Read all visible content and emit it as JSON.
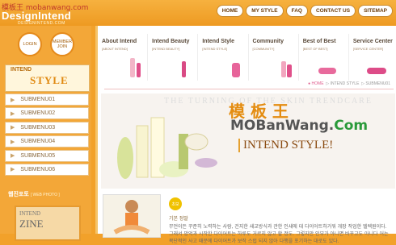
{
  "header": {
    "watermark": "模板王 mobanwang.com",
    "brand": "DesignIntend",
    "brand_sub": "DESIGNINTEND.COM",
    "nav": [
      "HOME",
      "MY STYLE",
      "FAQ",
      "CONTACT US",
      "SITEMAP"
    ]
  },
  "left": {
    "circles": [
      "LOGIN",
      "MEMBER JOIN"
    ],
    "style_label1": "INTEND",
    "style_label2": "STYLE",
    "menu": [
      "SUBMENU01",
      "SUBMENU02",
      "SUBMENU03",
      "SUBMENU04",
      "SUBMENU05",
      "SUBMENU06"
    ],
    "photo_title": "웹진포토",
    "photo_title_sub": "[ WEB PHOTO ]",
    "photo_t1": "INTEND",
    "photo_t2": "ZINE"
  },
  "categories": [
    {
      "title": "About Intend",
      "sub": "[ABOUT INTEND]"
    },
    {
      "title": "Intend Beauty",
      "sub": "[INTEND BEAUTY]"
    },
    {
      "title": "Intend Style",
      "sub": "[INTEND STYLE]"
    },
    {
      "title": "Community",
      "sub": "[COMMUNITY]"
    },
    {
      "title": "Best of Best",
      "sub": "[BEST OF BEST]"
    },
    {
      "title": "Service Center",
      "sub": "[SERVICE CENTER]"
    }
  ],
  "breadcrumb": {
    "home": "● HOME",
    "mid": "▷ INTEND STYLE",
    "last": "▷ SUBMENU01"
  },
  "banner": {
    "bg_text": "THE TURNING OF THE SKIN TRENDCARE",
    "title": "INTEND STYLE!",
    "wm1": "模 板 王",
    "wm2a": "MOBanWang.",
    "wm2b": "Com"
  },
  "content": {
    "badge": "초보",
    "heading": "기본 정말",
    "paragraph": "무언이든 꾸준히 노력하는 사람, 건지한 새교방식과 관한 인새에 대 다이어트하거워 개장 작업한 텔렉원이다. 그래서 망억과 시작한 다이어트는 하루도 거르지 않고 할 정도. 그렇지만 인부가 아니면 바꾸고도 아니다 어는 목단적인 사고 때문에 다이어트가 보작 스럽 되지 않아 다행을 포기하는 대로도 있다."
  },
  "colors": {
    "accent": "#f2a12a",
    "pink": "#e0508a"
  }
}
